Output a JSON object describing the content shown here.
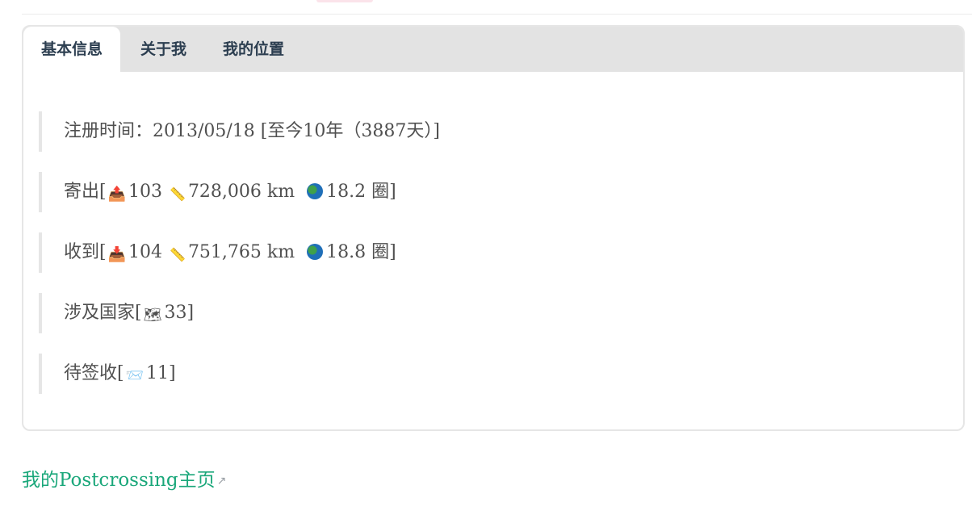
{
  "tabs": [
    {
      "label": "基本信息",
      "active": true
    },
    {
      "label": "关于我",
      "active": false
    },
    {
      "label": "我的位置",
      "active": false
    }
  ],
  "info": {
    "registered": "注册时间：2013/05/18 [至今10年（3887天）]",
    "sent": {
      "prefix": "寄出[",
      "count": "103",
      "distance": "728,006 km",
      "laps": "18.2 圈]"
    },
    "received": {
      "prefix": "收到[",
      "count": "104",
      "distance": "751,765 km",
      "laps": "18.8 圈]"
    },
    "countries": {
      "prefix": "涉及国家[",
      "count": "33]"
    },
    "pending": {
      "prefix": "待签收[",
      "count": "11]"
    }
  },
  "icons": {
    "outbox": "outbox-tray-icon",
    "inbox": "inbox-tray-icon",
    "ruler": "ruler-icon",
    "globe": "globe-icon",
    "map": "map-icon",
    "mail": "incoming-envelope-icon",
    "external": "external-link-icon"
  },
  "colors": {
    "link": "#1aa77a",
    "tab_bar": "#e3e3e3",
    "text": "#505050"
  },
  "footer": {
    "link_text": "我的Postcrossing主页"
  }
}
